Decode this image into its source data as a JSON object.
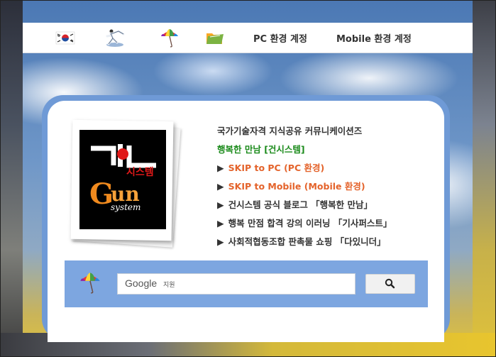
{
  "nav": {
    "icons": [
      "korea-flag-icon",
      "taekwondo-icon",
      "umbrella-icon",
      "folder-icon"
    ],
    "pc_label": "PC 환경 계정",
    "mobile_label": "Mobile 환경 계정"
  },
  "logo": {
    "brand_ko": "시스템",
    "brand_en": "Gun",
    "brand_sub": "system",
    "colors": {
      "white": "#ffffff",
      "red": "#e01919",
      "orange": "#f08a1e"
    }
  },
  "content": {
    "title": "국가기술자격 지식공유 커뮤니케이션즈",
    "tagline": "행복한 만남 [건시스템]",
    "links": [
      {
        "label": "SKIP to PC (PC 환경)"
      },
      {
        "label": "SKIP to Mobile (Mobile 환경)"
      },
      {
        "label": "건시스템 공식 블로그 「행복한 만남」"
      },
      {
        "label": "행복 만점 합격 강의 이러닝 「기사퍼스트」"
      },
      {
        "label": "사회적협동조합 판촉물 쇼핑 「다있니더」"
      }
    ],
    "arrow": "▶"
  },
  "search": {
    "engine": "Google",
    "engine_sub": "지원",
    "button_icon": "search-icon"
  },
  "colors": {
    "accent_blue": "#6f9ad6",
    "green": "#1a8a1a",
    "orange": "#e4632b"
  }
}
